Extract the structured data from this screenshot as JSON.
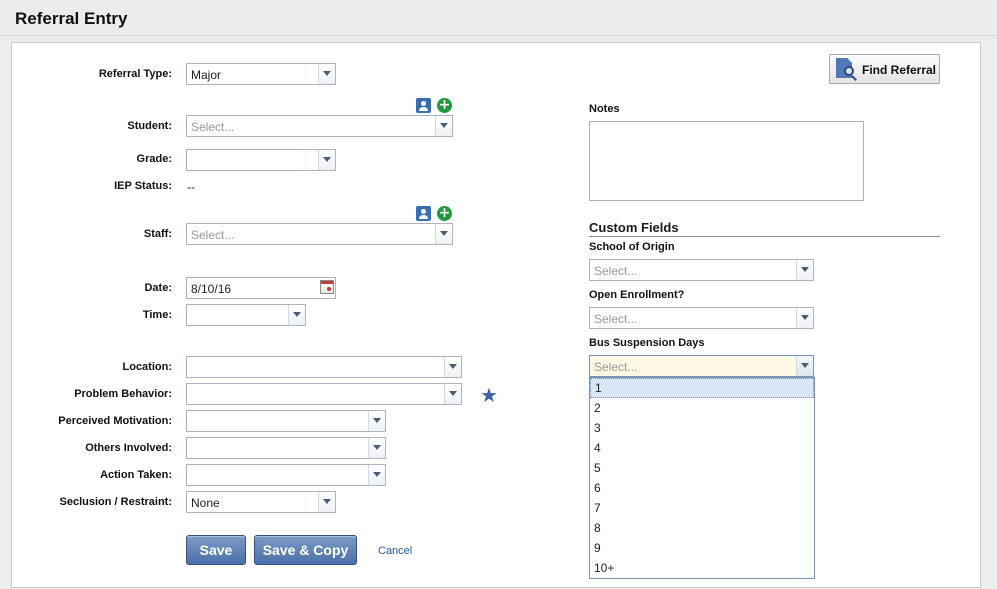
{
  "page": {
    "title": "Referral Entry"
  },
  "find_referral": {
    "label": "Find Referral"
  },
  "form": {
    "referral_type": {
      "label": "Referral Type:",
      "value": "Major"
    },
    "student": {
      "label": "Student:",
      "placeholder": "Select..."
    },
    "grade": {
      "label": "Grade:",
      "value": ""
    },
    "iep_status": {
      "label": "IEP Status:",
      "value": "--"
    },
    "staff": {
      "label": "Staff:",
      "placeholder": "Select..."
    },
    "date": {
      "label": "Date:",
      "value": "8/10/16"
    },
    "time": {
      "label": "Time:",
      "value": ""
    },
    "location": {
      "label": "Location:",
      "value": ""
    },
    "problem_behavior": {
      "label": "Problem Behavior:",
      "value": ""
    },
    "perceived_motivation": {
      "label": "Perceived Motivation:",
      "value": ""
    },
    "others_involved": {
      "label": "Others Involved:",
      "value": ""
    },
    "action_taken": {
      "label": "Action Taken:",
      "value": ""
    },
    "seclusion_restraint": {
      "label": "Seclusion / Restraint:",
      "value": "None"
    }
  },
  "actions": {
    "save": "Save",
    "save_copy": "Save & Copy",
    "cancel": "Cancel"
  },
  "notes": {
    "label": "Notes",
    "value": ""
  },
  "custom_fields": {
    "title": "Custom Fields",
    "school_of_origin": {
      "label": "School of Origin",
      "placeholder": "Select..."
    },
    "open_enrollment": {
      "label": "Open Enrollment?",
      "placeholder": "Select..."
    },
    "bus_suspension_days": {
      "label": "Bus Suspension Days",
      "placeholder": "Select...",
      "options": [
        "1",
        "2",
        "3",
        "4",
        "5",
        "6",
        "7",
        "8",
        "9",
        "10+"
      ],
      "hovered_option": "1"
    }
  },
  "colors": {
    "button_blue": "#4a6fa8",
    "link_blue": "#2a5aa8",
    "add_green": "#1e9a3c",
    "active_field_bg": "#fdf9e4"
  }
}
